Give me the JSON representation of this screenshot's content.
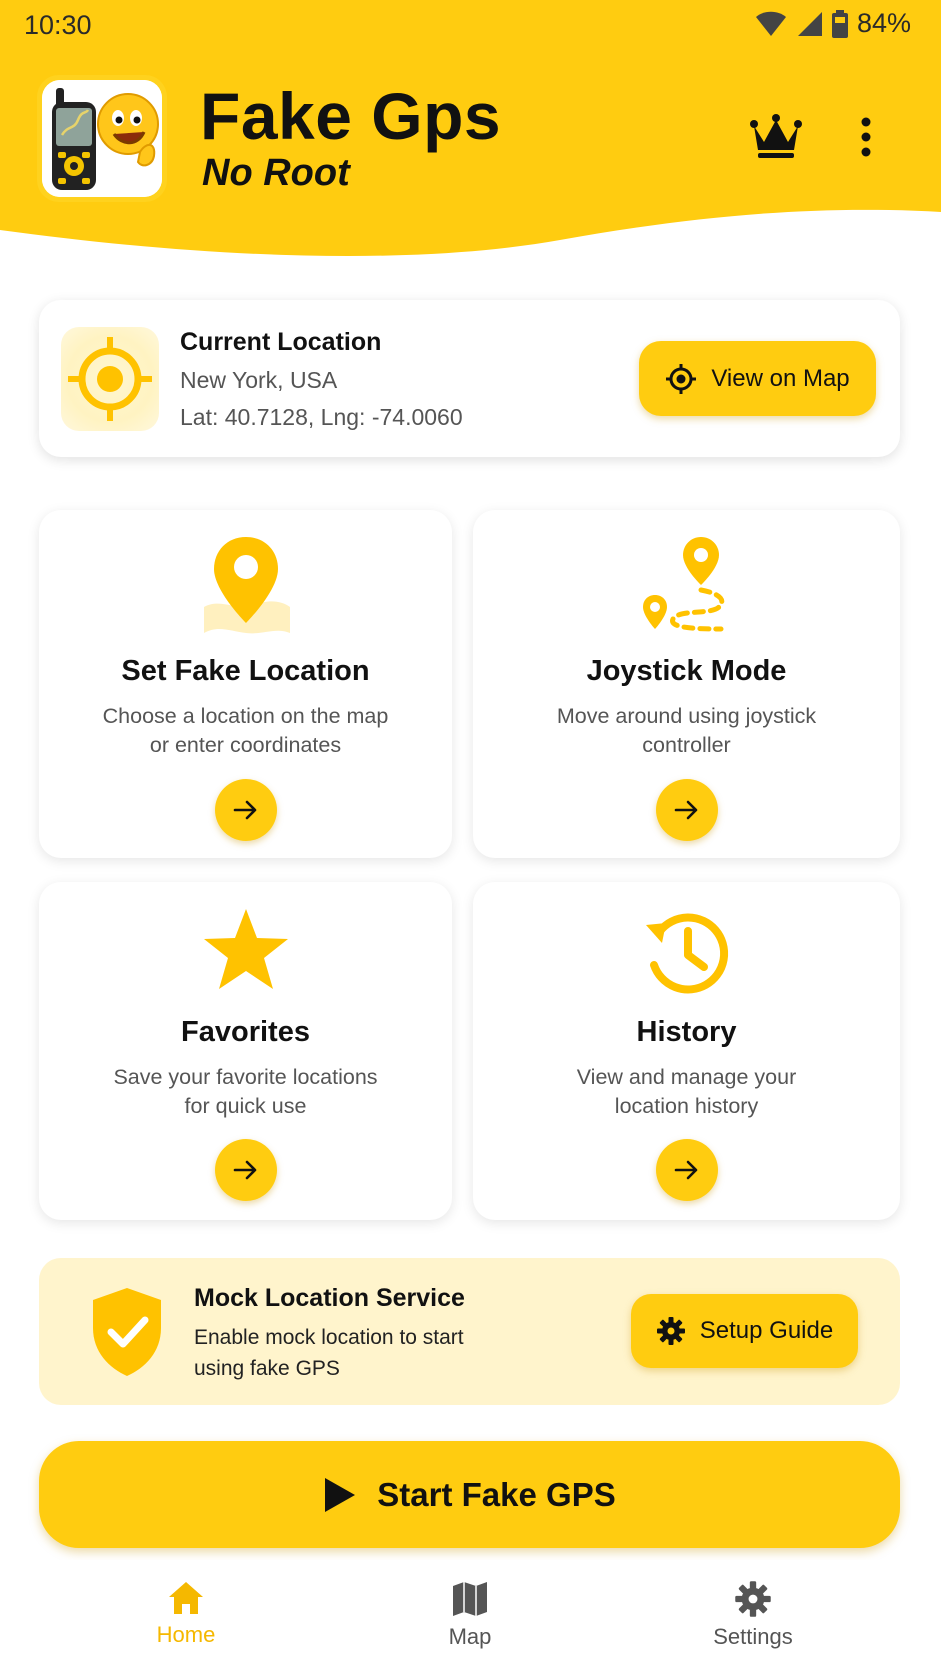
{
  "status_bar": {
    "time": "10:30",
    "battery": "84%"
  },
  "header": {
    "title": "Fake Gps",
    "subtitle": "No Root"
  },
  "current_location": {
    "title": "Current Location",
    "city": "New York, USA",
    "coords": "Lat: 40.7128, Lng: -74.0060",
    "button_label": "View on Map"
  },
  "features": [
    {
      "title": "Set Fake Location",
      "desc_line1": "Choose a location on the map",
      "desc_line2": "or enter coordinates"
    },
    {
      "title": "Joystick Mode",
      "desc_line1": "Move around using joystick",
      "desc_line2": "controller"
    },
    {
      "title": "Favorites",
      "desc_line1": "Save your favorite locations",
      "desc_line2": "for quick use"
    },
    {
      "title": "History",
      "desc_line1": "View and manage your",
      "desc_line2": "location history"
    }
  ],
  "mock_service": {
    "title": "Mock Location Service",
    "desc_line1": "Enable mock location to start",
    "desc_line2": "using fake GPS",
    "button_label": "Setup Guide"
  },
  "start_button": {
    "label": "Start Fake GPS"
  },
  "bottom_nav": {
    "items": [
      {
        "label": "Home",
        "active": true
      },
      {
        "label": "Map",
        "active": false
      },
      {
        "label": "Settings",
        "active": false
      }
    ]
  },
  "colors": {
    "accent": "#ffcc10",
    "header": "#ffcc10",
    "active_nav": "#f5b800",
    "inactive_nav": "#555555"
  },
  "icons": [
    "wifi-icon",
    "signal-icon",
    "battery-icon",
    "crown-icon",
    "more-vert-icon",
    "crosshair-icon",
    "pin-map-icon",
    "route-icon",
    "star-icon",
    "history-icon",
    "arrow-right-icon",
    "shield-check-icon",
    "gear-icon",
    "play-icon",
    "home-icon",
    "map-icon"
  ]
}
